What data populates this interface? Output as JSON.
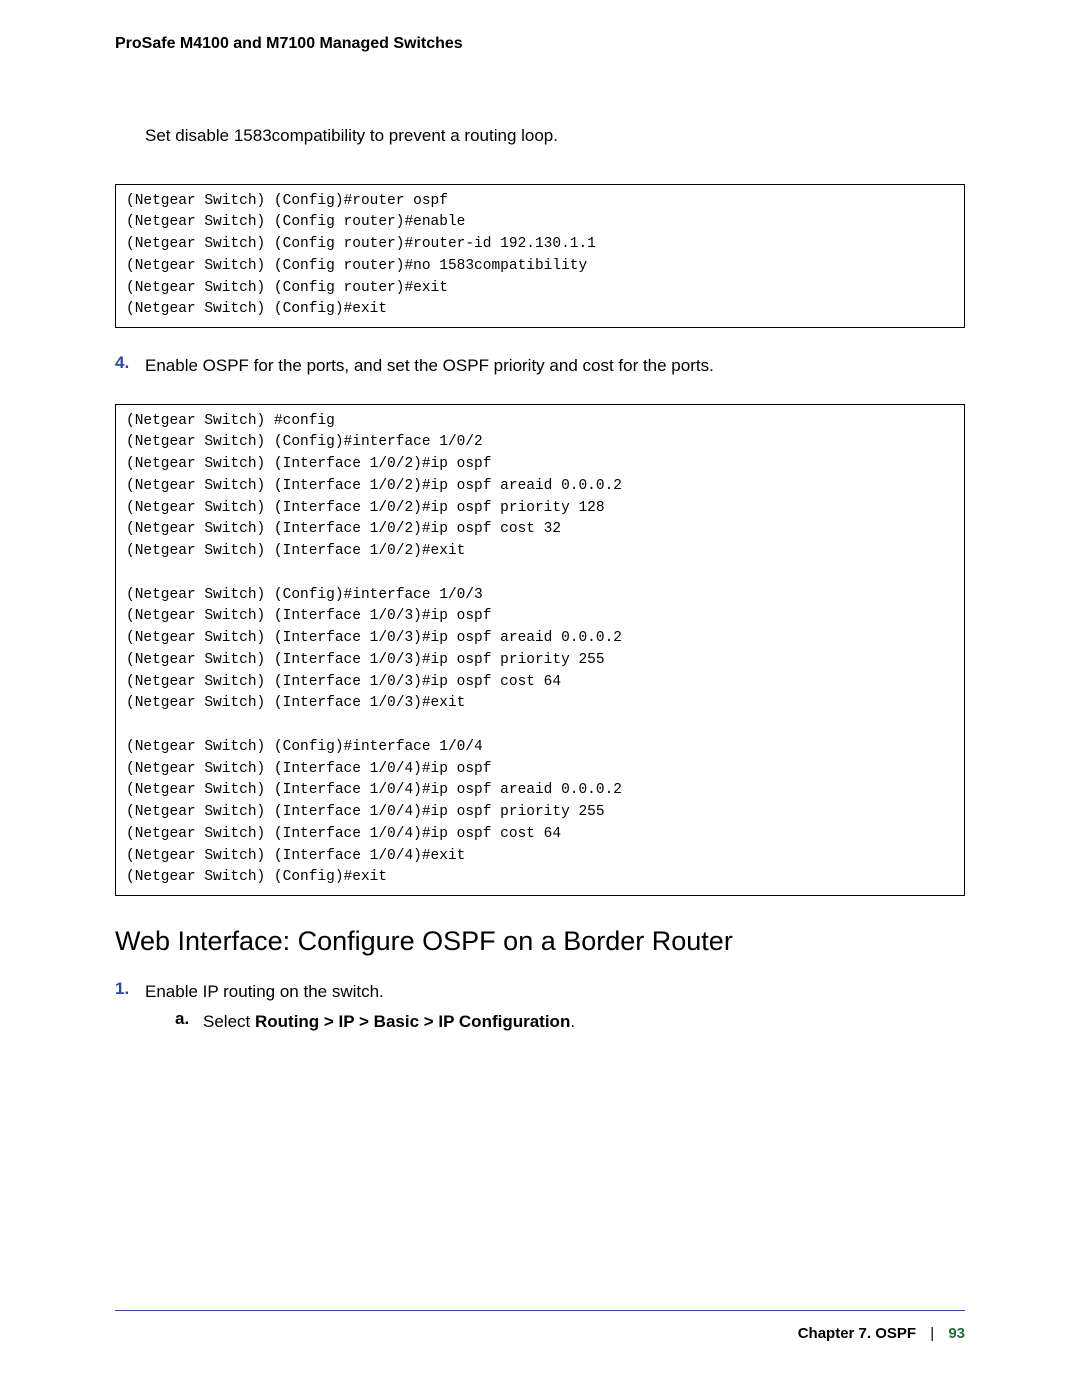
{
  "header": {
    "title": "ProSafe M4100 and M7100 Managed Switches"
  },
  "intro": "Set disable 1583compatibility to prevent a routing loop.",
  "code1": "(Netgear Switch) (Config)#router ospf\n(Netgear Switch) (Config router)#enable\n(Netgear Switch) (Config router)#router-id 192.130.1.1\n(Netgear Switch) (Config router)#no 1583compatibility\n(Netgear Switch) (Config router)#exit\n(Netgear Switch) (Config)#exit",
  "step4": {
    "num": "4.",
    "text": "Enable OSPF for the ports, and set the OSPF priority and cost for the ports."
  },
  "code2": "(Netgear Switch) #config\n(Netgear Switch) (Config)#interface 1/0/2\n(Netgear Switch) (Interface 1/0/2)#ip ospf\n(Netgear Switch) (Interface 1/0/2)#ip ospf areaid 0.0.0.2\n(Netgear Switch) (Interface 1/0/2)#ip ospf priority 128\n(Netgear Switch) (Interface 1/0/2)#ip ospf cost 32\n(Netgear Switch) (Interface 1/0/2)#exit\n\n(Netgear Switch) (Config)#interface 1/0/3\n(Netgear Switch) (Interface 1/0/3)#ip ospf\n(Netgear Switch) (Interface 1/0/3)#ip ospf areaid 0.0.0.2\n(Netgear Switch) (Interface 1/0/3)#ip ospf priority 255\n(Netgear Switch) (Interface 1/0/3)#ip ospf cost 64\n(Netgear Switch) (Interface 1/0/3)#exit\n\n(Netgear Switch) (Config)#interface 1/0/4\n(Netgear Switch) (Interface 1/0/4)#ip ospf\n(Netgear Switch) (Interface 1/0/4)#ip ospf areaid 0.0.0.2\n(Netgear Switch) (Interface 1/0/4)#ip ospf priority 255\n(Netgear Switch) (Interface 1/0/4)#ip ospf cost 64\n(Netgear Switch) (Interface 1/0/4)#exit\n(Netgear Switch) (Config)#exit",
  "section": {
    "title": "Web Interface: Configure OSPF on a Border Router"
  },
  "step1": {
    "num": "1.",
    "text": "Enable IP routing on the switch.",
    "a": {
      "label": "a.",
      "prefix": "Select ",
      "bold": "Routing > IP > Basic > IP Configuration",
      "suffix": "."
    }
  },
  "footer": {
    "chapter": "Chapter 7.  OSPF",
    "sep": "|",
    "page": "93"
  }
}
